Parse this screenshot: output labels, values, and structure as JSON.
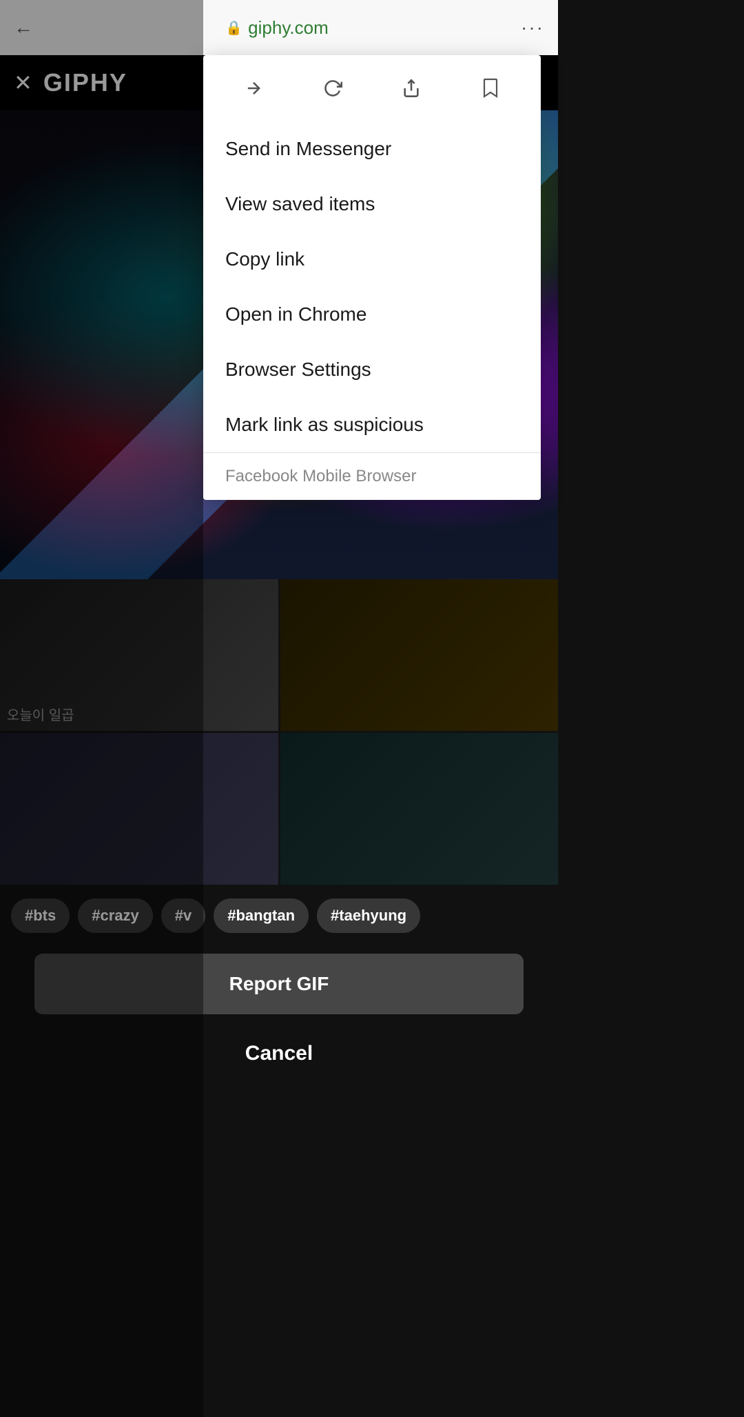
{
  "addressBar": {
    "url": "giphy.com",
    "backLabel": "←",
    "moreLabel": "···",
    "lockIcon": "🔒"
  },
  "giphyHeader": {
    "closeLabel": "✕",
    "logoLabel": "GIPHY"
  },
  "dropdown": {
    "forwardIcon": "forward-icon",
    "reloadIcon": "reload-icon",
    "shareIcon": "share-icon",
    "bookmarkIcon": "bookmark-icon",
    "items": [
      {
        "label": "Send in Messenger",
        "key": "send-in-messenger"
      },
      {
        "label": "View saved items",
        "key": "view-saved-items"
      },
      {
        "label": "Copy link",
        "key": "copy-link"
      },
      {
        "label": "Open in Chrome",
        "key": "open-in-chrome"
      },
      {
        "label": "Browser Settings",
        "key": "browser-settings"
      },
      {
        "label": "Mark link as suspicious",
        "key": "mark-suspicious"
      }
    ],
    "footer": "Facebook Mobile Browser"
  },
  "tags": [
    "#bts",
    "#crazy",
    "#v",
    "#bangtan",
    "#taehyung"
  ],
  "gridItems": [
    {
      "text": "오늘이 일곱"
    },
    {
      "text": ""
    },
    {
      "text": ""
    },
    {
      "text": ""
    }
  ],
  "reportGifLabel": "Report GIF",
  "cancelLabel": "Cancel"
}
